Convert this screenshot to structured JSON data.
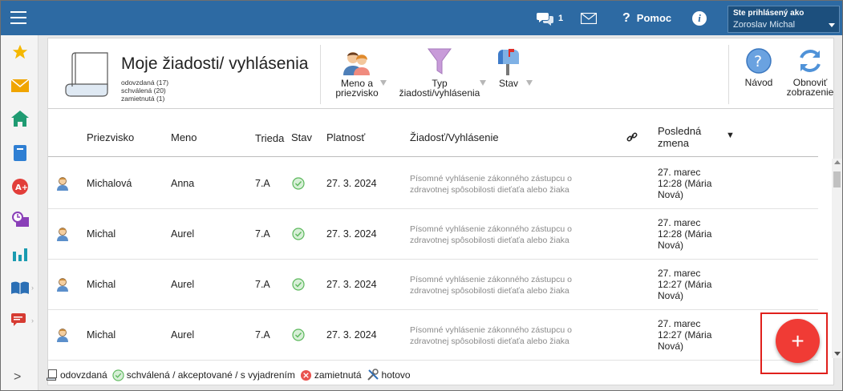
{
  "topbar": {
    "messages_count": "1",
    "help_label": "Pomoc",
    "info_symbol": "i",
    "login_label": "Ste prihlásený ako",
    "user_name": "Zoroslav Michal"
  },
  "page": {
    "title": "Moje žiadosti/ vyhlásenia",
    "counts": [
      "odovzdaná (17)",
      "schválená (20)",
      "zamietnutá (1)"
    ]
  },
  "filters": [
    {
      "line1": "Meno a",
      "line2": "priezvisko"
    },
    {
      "line1": "Typ",
      "line2": "žiadosti/vyhlásenia"
    },
    {
      "line1": "Stav",
      "line2": ""
    }
  ],
  "tools": {
    "guide_label": "Návod",
    "refresh_line1": "Obnoviť",
    "refresh_line2": "zobrazenie"
  },
  "table": {
    "headers": {
      "surname": "Priezvisko",
      "name": "Meno",
      "class": "Trieda",
      "status": "Stav",
      "validity": "Platnosť",
      "request": "Žiadosť/Vyhlásenie",
      "last_change_1": "Posledná",
      "last_change_2": "zmena",
      "sort_indicator": "▼"
    },
    "rows": [
      {
        "surname": "Michalová",
        "name": "Anna",
        "class": "7.A",
        "status": "schválená",
        "validity": "27. 3. 2024",
        "request_1": "Písomné vyhlásenie zákonného zástupcu o",
        "request_2": "zdravotnej spôsobilosti dieťaťa alebo žiaka",
        "change_1": "27. marec",
        "change_2": "12:28 (Mária",
        "change_3": "Nová)"
      },
      {
        "surname": "Michal",
        "name": "Aurel",
        "class": "7.A",
        "status": "schválená",
        "validity": "27. 3. 2024",
        "request_1": "Písomné vyhlásenie zákonného zástupcu o",
        "request_2": "zdravotnej spôsobilosti dieťaťa alebo žiaka",
        "change_1": "27. marec",
        "change_2": "12:28 (Mária",
        "change_3": "Nová)"
      },
      {
        "surname": "Michal",
        "name": "Aurel",
        "class": "7.A",
        "status": "schválená",
        "validity": "27. 3. 2024",
        "request_1": "Písomné vyhlásenie zákonného zástupcu o",
        "request_2": "zdravotnej spôsobilosti dieťaťa alebo žiaka",
        "change_1": "27. marec",
        "change_2": "12:27 (Mária",
        "change_3": "Nová)"
      },
      {
        "surname": "Michal",
        "name": "Aurel",
        "class": "7.A",
        "status": "schválená",
        "validity": "27. 3. 2024",
        "request_1": "Písomné vyhlásenie zákonného zástupcu o",
        "request_2": "zdravotnej spôsobilosti dieťaťa alebo žiaka",
        "change_1": "27. marec",
        "change_2": "12:27 (Mária",
        "change_3": "Nová)"
      }
    ]
  },
  "legend": {
    "submitted": "odovzdaná",
    "approved": "schválená / akceptované / s vyjadrením",
    "rejected": "zamietnutá",
    "done": "hotovo"
  },
  "fab_symbol": "+",
  "collapse_symbol": ">",
  "colors": {
    "topbar": "#2d6aa3",
    "approved": "#5cb85c",
    "rejected": "#e9534f",
    "fab": "#f03b35"
  }
}
